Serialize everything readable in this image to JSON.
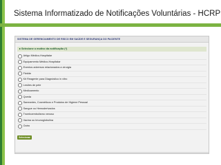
{
  "slide": {
    "title": "Sistema Informatizado de Notificações Voluntárias - HCRP",
    "accent_dark": "#2e7d32",
    "accent_light": "#8bc34a"
  },
  "app": {
    "header_title": "SISTEMA DE GERENCIAMENTO DE RISCO EM SAÚDE E SEGURANÇA DO PACIENTE",
    "section_title": "Selecione o motivo da notificação (*)",
    "options": [
      "Artigo Médico-Hospitalar",
      "Equipamento Médico-Hospitalar",
      "Eventos adversos relacionados a cirurgia",
      "Flebite",
      "Kit Reagente para Diagnóstico in vitro",
      "Lesões de pele",
      "Medicamento",
      "Queda",
      "Saneantes, Cosméticos e Produtos de Higiene Pessoal",
      "Sangue ou Hemoderivados",
      "Tromboembolismo venoso",
      "Vacina ou Imunoglobulina",
      "Outro"
    ],
    "submit_label": "Selecionar",
    "button_color": "#6e8e25"
  }
}
